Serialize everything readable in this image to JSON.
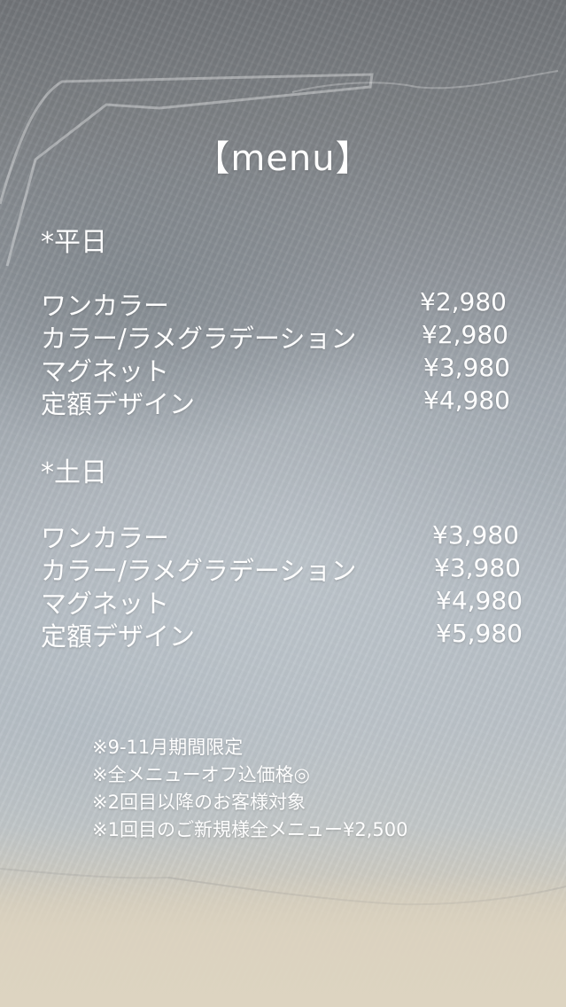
{
  "title": "【menu】",
  "weekday": {
    "label": "*平日",
    "items": [
      {
        "name": "ワンカラー",
        "price": "¥2,980"
      },
      {
        "name": "カラー/ラメグラデーション",
        "price": "¥2,980"
      },
      {
        "name": "マグネット",
        "price": "¥3,980"
      },
      {
        "name": "定額デザイン",
        "price": "¥4,980"
      }
    ]
  },
  "weekend": {
    "label": "*土日",
    "items": [
      {
        "name": "ワンカラー",
        "price": "¥3,980"
      },
      {
        "name": "カラー/ラメグラデーション",
        "price": "¥3,980"
      },
      {
        "name": "マグネット",
        "price": "¥4,980"
      },
      {
        "name": "定額デザイン",
        "price": "¥5,980"
      }
    ]
  },
  "notes": [
    "※9-11月期間限定",
    "※全メニューオフ込価格◎",
    "※2回目以降のお客様対象",
    "※1回目のご新規様全メニュー¥2,500"
  ]
}
